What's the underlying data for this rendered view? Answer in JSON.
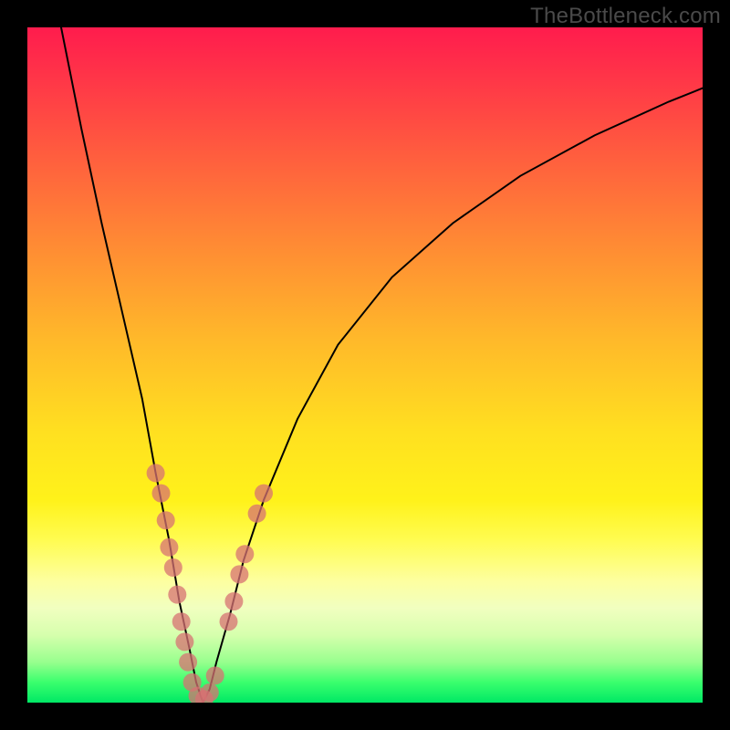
{
  "watermark": {
    "text": "TheBottleneck.com"
  },
  "colors": {
    "frame": "#000000",
    "curve": "#000000",
    "dot": "#d77273",
    "gradient_top": "#ff1c4d",
    "gradient_bottom": "#00e865"
  },
  "chart_data": {
    "type": "line",
    "title": "",
    "xlabel": "",
    "ylabel": "",
    "xlim": [
      0,
      100
    ],
    "ylim": [
      0,
      100
    ],
    "grid": false,
    "notes": "V-shaped bottleneck curve on red-yellow-green gradient. Y axis is inverted visually (high values at top in red, low/zero at bottom in green). Values are estimated from pixel geometry; no axis ticks or labels are shown in the image.",
    "series": [
      {
        "name": "bottleneck-curve",
        "x": [
          5,
          8,
          11,
          14,
          17,
          19,
          21,
          22.5,
          24,
          25,
          26,
          27,
          28,
          30,
          32,
          35,
          40,
          46,
          54,
          63,
          73,
          84,
          95,
          100
        ],
        "y": [
          100,
          85,
          71,
          58,
          45,
          34,
          24,
          15,
          8,
          3,
          0,
          2,
          6,
          13,
          21,
          30,
          42,
          53,
          63,
          71,
          78,
          84,
          89,
          91
        ]
      }
    ],
    "scatter": {
      "name": "sample-dots",
      "points": [
        {
          "x": 19.0,
          "y": 34
        },
        {
          "x": 19.8,
          "y": 31
        },
        {
          "x": 20.5,
          "y": 27
        },
        {
          "x": 21.0,
          "y": 23
        },
        {
          "x": 21.6,
          "y": 20
        },
        {
          "x": 22.2,
          "y": 16
        },
        {
          "x": 22.8,
          "y": 12
        },
        {
          "x": 23.3,
          "y": 9
        },
        {
          "x": 23.8,
          "y": 6
        },
        {
          "x": 24.4,
          "y": 3
        },
        {
          "x": 25.2,
          "y": 1
        },
        {
          "x": 26.2,
          "y": 0.5
        },
        {
          "x": 27.0,
          "y": 1.5
        },
        {
          "x": 27.8,
          "y": 4
        },
        {
          "x": 29.8,
          "y": 12
        },
        {
          "x": 30.6,
          "y": 15
        },
        {
          "x": 31.4,
          "y": 19
        },
        {
          "x": 32.2,
          "y": 22
        },
        {
          "x": 34.0,
          "y": 28
        },
        {
          "x": 35.0,
          "y": 31
        }
      ]
    }
  }
}
